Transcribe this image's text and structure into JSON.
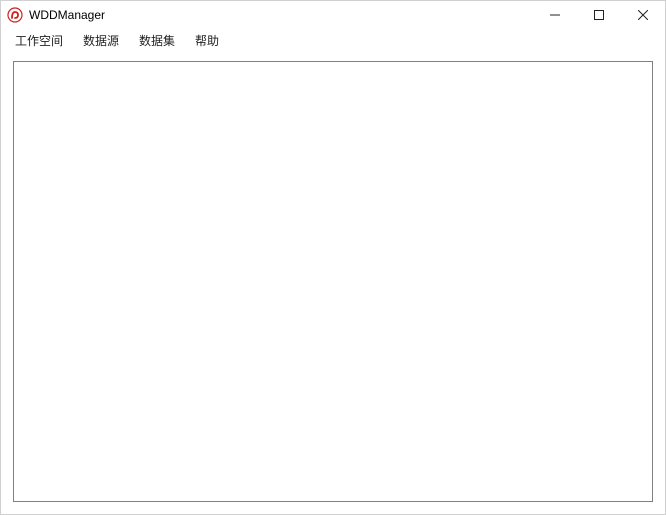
{
  "window": {
    "title": "WDDManager"
  },
  "menubar": {
    "items": [
      {
        "label": "工作空间"
      },
      {
        "label": "数据源"
      },
      {
        "label": "数据集"
      },
      {
        "label": "帮助"
      }
    ]
  }
}
